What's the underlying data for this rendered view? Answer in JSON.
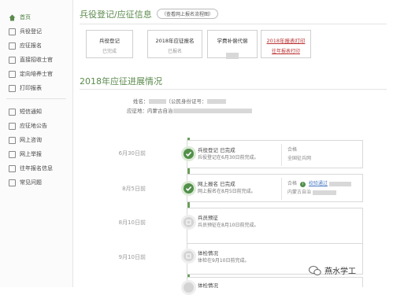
{
  "sidebar": {
    "items": [
      {
        "label": "首页",
        "icon": "home-icon"
      },
      {
        "label": "兵役登记",
        "icon": "register-icon"
      },
      {
        "label": "应征报名",
        "icon": "signup-icon"
      },
      {
        "label": "直接招收士官",
        "icon": "recruit-icon"
      },
      {
        "label": "定向培养士官",
        "icon": "training-icon"
      },
      {
        "label": "打印报表",
        "icon": "print-icon"
      },
      {
        "label": "短信通知",
        "icon": "sms-icon"
      },
      {
        "label": "应征地公告",
        "icon": "notice-icon"
      },
      {
        "label": "网上咨询",
        "icon": "consult-icon"
      },
      {
        "label": "网上举报",
        "icon": "report-icon"
      },
      {
        "label": "往年报名信息",
        "icon": "history-icon"
      },
      {
        "label": "常见问题",
        "icon": "faq-icon"
      }
    ],
    "accent": "#5b8a4d"
  },
  "header": {
    "title": "兵役登记/应征信息",
    "note": "（查看网上报名流程图）"
  },
  "cards": [
    {
      "title": "兵役登记",
      "status": "已完成"
    },
    {
      "title": "2018年应征报名",
      "status": "已报名"
    },
    {
      "title": "学费补偿代偿",
      "status": ""
    },
    {
      "title": "2018年报表打印",
      "status": "往年报表打印"
    }
  ],
  "progress": {
    "title": "2018年应征进展情况",
    "name_label": "姓名：",
    "id_label": "（公民身份证号：",
    "place_label": "应征地：",
    "place_value": "内蒙古自治"
  },
  "timeline": [
    {
      "date": "6月30日前",
      "title": "兵役登记  已完成",
      "desc": "兵役登记在6月30日前完成。",
      "r1": "合格",
      "r2": "全国征兵网",
      "done": true
    },
    {
      "date": "8月5日前",
      "title": "网上报名  已完成",
      "desc": "网上报名在8月5日前完成。",
      "r1": "合格",
      "r1_link": "校验通过",
      "r2": "内蒙古自治",
      "done": true
    },
    {
      "date": "8月10日前",
      "title": "兵员预征",
      "desc": "兵员预征在8月10日前完成。",
      "r1": "",
      "r2": "",
      "done": false
    },
    {
      "date": "9月10日前",
      "title": "体检情况",
      "desc": "体检在9月10日前完成。",
      "r1": "",
      "r2": "",
      "done": false
    },
    {
      "date": "",
      "title": "体检情况",
      "desc": "",
      "r1": "",
      "r2": "",
      "done": false
    }
  ],
  "watermark": "燕水学工"
}
